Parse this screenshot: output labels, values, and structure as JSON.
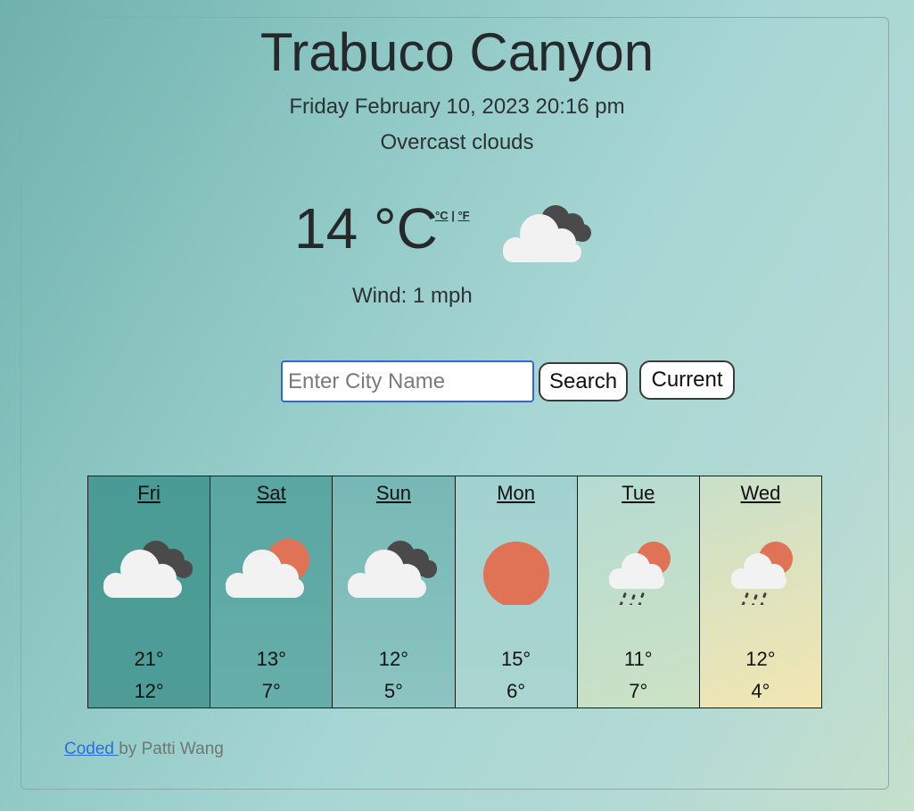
{
  "city": "Trabuco Canyon",
  "datetime": "Friday February 10, 2023 20:16 pm",
  "description": "Overcast clouds",
  "current": {
    "temperature": "14 °C",
    "unit_celsius": "°C",
    "unit_separator": "|",
    "unit_fahrenheit": "°F",
    "icon": "overcast-clouds-icon",
    "wind": "Wind: 1 mph"
  },
  "search": {
    "placeholder": "Enter City Name",
    "value": "",
    "search_label": "Search",
    "current_label": "Current"
  },
  "forecast": [
    {
      "day": "Fri",
      "icon": "overcast-clouds-icon",
      "high": "21°",
      "low": "12°"
    },
    {
      "day": "Sat",
      "icon": "partly-cloudy-icon",
      "high": "13°",
      "low": "7°"
    },
    {
      "day": "Sun",
      "icon": "overcast-clouds-icon",
      "high": "12°",
      "low": "5°"
    },
    {
      "day": "Mon",
      "icon": "sun-icon",
      "high": "15°",
      "low": "6°"
    },
    {
      "day": "Tue",
      "icon": "rain-sun-icon",
      "high": "11°",
      "low": "7°"
    },
    {
      "day": "Wed",
      "icon": "rain-sun-icon",
      "high": "12°",
      "low": "4°"
    }
  ],
  "footer": {
    "link_text": "Coded ",
    "author_text": "by Patti Wang"
  },
  "colors": {
    "sun": "#e07355",
    "cloud_light": "#f2f2f2",
    "cloud_dark": "#4a4a4a",
    "link": "#2b6de8",
    "input_focus": "#2f6ad0"
  }
}
